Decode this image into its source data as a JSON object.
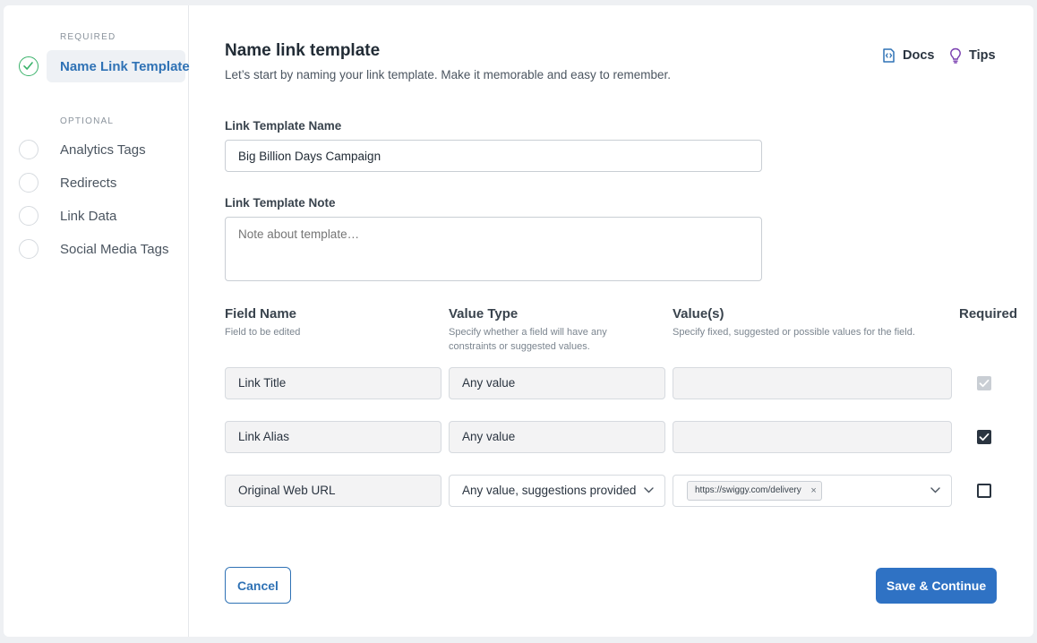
{
  "sidebar": {
    "required_label": "REQUIRED",
    "optional_label": "OPTIONAL",
    "required_items": [
      {
        "label": "Name Link Template"
      }
    ],
    "optional_items": [
      {
        "label": "Analytics Tags"
      },
      {
        "label": "Redirects"
      },
      {
        "label": "Link Data"
      },
      {
        "label": "Social Media Tags"
      }
    ]
  },
  "header": {
    "title": "Name link template",
    "subtitle": "Let’s start by naming your link template. Make it memorable and easy to remember.",
    "docs_label": "Docs",
    "tips_label": "Tips"
  },
  "form": {
    "name_label": "Link Template Name",
    "name_value": "Big Billion Days Campaign",
    "note_label": "Link Template Note",
    "note_placeholder": "Note about template…"
  },
  "table": {
    "columns": [
      {
        "title": "Field Name",
        "subtitle": "Field to be edited"
      },
      {
        "title": "Value Type",
        "subtitle": "Specify whether a field will have any constraints or suggested values."
      },
      {
        "title": "Value(s)",
        "subtitle": "Specify fixed, suggested or possible values for the field."
      },
      {
        "title": "Required",
        "subtitle": ""
      }
    ],
    "rows": [
      {
        "field": "Link Title",
        "value_type": "Any value",
        "values": "",
        "required": "checked-disabled"
      },
      {
        "field": "Link Alias",
        "value_type": "Any value",
        "values": "",
        "required": "checked"
      },
      {
        "field": "Original Web URL",
        "value_type": "Any value, suggestions provided",
        "values_tag": "https://swiggy.com/delivery",
        "required": "unchecked"
      }
    ]
  },
  "footer": {
    "cancel_label": "Cancel",
    "save_label": "Save & Continue"
  },
  "colors": {
    "accent": "#2f72c4",
    "success": "#39b26a",
    "sidebar_active_bg": "#eef1f5"
  }
}
